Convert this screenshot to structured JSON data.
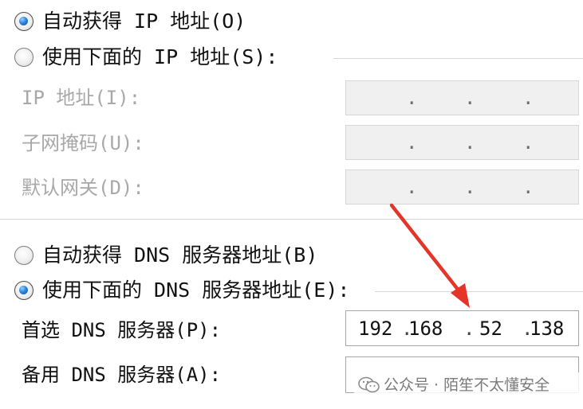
{
  "ip_section": {
    "auto_option": {
      "label": "自动获得 IP 地址(O)",
      "selected": true
    },
    "manual_option": {
      "label": "使用下面的 IP 地址(S):",
      "selected": false
    },
    "fields": [
      {
        "label": "IP 地址(I):",
        "octets": [
          "",
          "",
          "",
          ""
        ],
        "enabled": false
      },
      {
        "label": "子网掩码(U):",
        "octets": [
          "",
          "",
          "",
          ""
        ],
        "enabled": false
      },
      {
        "label": "默认网关(D):",
        "octets": [
          "",
          "",
          "",
          ""
        ],
        "enabled": false
      }
    ]
  },
  "dns_section": {
    "auto_option": {
      "label": "自动获得 DNS 服务器地址(B)",
      "selected": false
    },
    "manual_option": {
      "label": "使用下面的 DNS 服务器地址(E):",
      "selected": true
    },
    "fields": [
      {
        "label": "首选 DNS 服务器(P):",
        "octets": [
          "192",
          "168",
          "52",
          "138"
        ],
        "enabled": true
      },
      {
        "label": "备用 DNS 服务器(A):",
        "octets": [
          "",
          "",
          "",
          ""
        ],
        "enabled": true
      }
    ]
  },
  "watermark": {
    "text": "公众号 · 陌笙不太懂安全",
    "icon": "wechat-icon"
  },
  "annotation": {
    "icon": "red-arrow-icon",
    "color": "#e53428"
  },
  "colors": {
    "radio_dot": "#2c87dd",
    "disabled_text": "#a8a8a8",
    "disabled_box": "#f0f0f0"
  }
}
